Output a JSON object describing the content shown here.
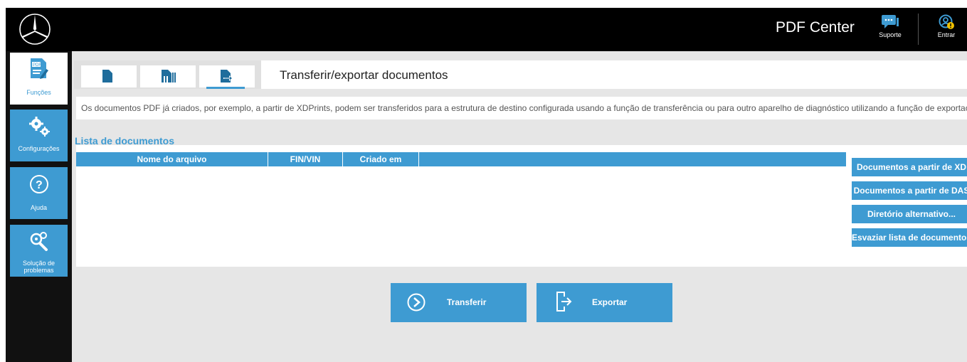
{
  "app": {
    "title": "PDF Center"
  },
  "topbar": {
    "support_label": "Suporte",
    "login_label": "Entrar",
    "logo_icon": "mercedes-star-icon"
  },
  "sidebar": {
    "items": [
      {
        "label": "Funções",
        "icon": "pdf-document-icon",
        "active": true
      },
      {
        "label": "Configurações",
        "icon": "gears-icon",
        "active": false
      },
      {
        "label": "Ajuda",
        "icon": "help-icon",
        "active": false
      },
      {
        "label": "Solução de problemas",
        "icon": "troubleshoot-gears-icon",
        "active": false
      }
    ]
  },
  "tabs": [
    {
      "icon": "document-icon",
      "active": false
    },
    {
      "icon": "document-stack-icon",
      "active": false
    },
    {
      "icon": "document-export-icon",
      "active": true
    }
  ],
  "section": {
    "title": "Transferir/exportar documentos",
    "description": "Os documentos PDF já criados, por exemplo, a partir de XDPrints, podem ser transferidos para a estrutura de destino configurada usando a função de transferência ou para outro aparelho de diagnóstico utilizando a função de exportação."
  },
  "document_list": {
    "title": "Lista de documentos",
    "columns": [
      "Nome do arquivo",
      "FIN/VIN",
      "Criado em",
      ""
    ],
    "rows": []
  },
  "side_buttons": {
    "from_xd": "Documentos a partir de XD",
    "from_das": "Documentos a partir de DAS",
    "alt_dir": "Diretório alternativo...",
    "clear_list": "Esvaziar lista de documentos"
  },
  "actions": {
    "transfer_label": "Transferir",
    "export_label": "Exportar"
  },
  "colors": {
    "accent": "#3e9bd2",
    "topbar": "#000000",
    "sidebar": "#111111",
    "background": "#e6e6e6"
  }
}
